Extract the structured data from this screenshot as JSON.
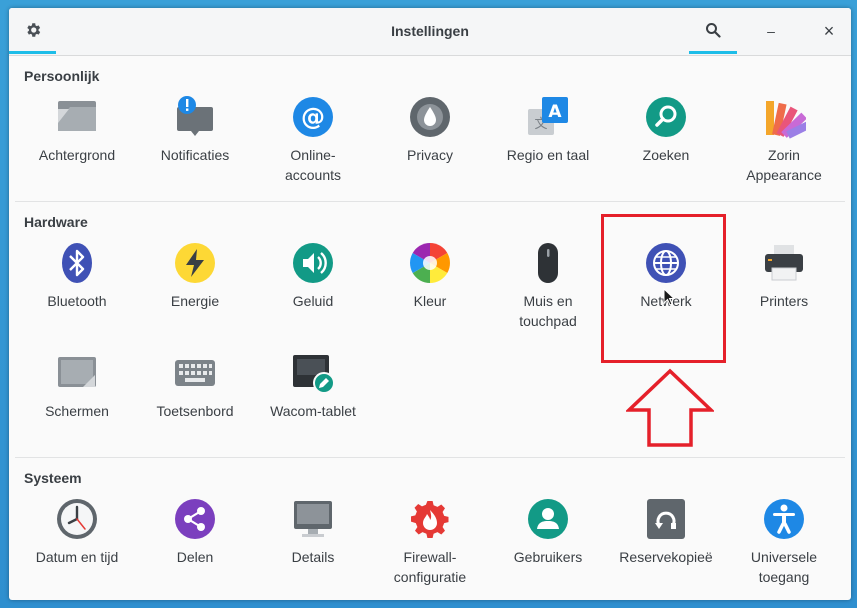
{
  "window": {
    "title": "Instellingen"
  },
  "headerbar": {
    "minimize_glyph": "–",
    "close_glyph": "×"
  },
  "sections": {
    "personal": {
      "title": "Persoonlijk",
      "items": [
        {
          "label1": "Achtergrond",
          "label2": "",
          "icon": "background-icon"
        },
        {
          "label1": "Notificaties",
          "label2": "",
          "icon": "notifications-icon"
        },
        {
          "label1": "Online-",
          "label2": "accounts",
          "icon": "online-accounts-icon"
        },
        {
          "label1": "Privacy",
          "label2": "",
          "icon": "privacy-icon"
        },
        {
          "label1": "Regio en taal",
          "label2": "",
          "icon": "region-language-icon"
        },
        {
          "label1": "Zoeken",
          "label2": "",
          "icon": "search-settings-icon"
        },
        {
          "label1": "Zorin",
          "label2": "Appearance",
          "icon": "zorin-appearance-icon"
        }
      ]
    },
    "hardware": {
      "title": "Hardware",
      "items": [
        {
          "label1": "Bluetooth",
          "label2": "",
          "icon": "bluetooth-icon"
        },
        {
          "label1": "Energie",
          "label2": "",
          "icon": "power-icon"
        },
        {
          "label1": "Geluid",
          "label2": "",
          "icon": "sound-icon"
        },
        {
          "label1": "Kleur",
          "label2": "",
          "icon": "color-icon"
        },
        {
          "label1": "Muis en",
          "label2": "touchpad",
          "icon": "mouse-icon"
        },
        {
          "label1": "Netwerk",
          "label2": "",
          "icon": "network-icon"
        },
        {
          "label1": "Printers",
          "label2": "",
          "icon": "printer-icon"
        },
        {
          "label1": "Schermen",
          "label2": "",
          "icon": "displays-icon"
        },
        {
          "label1": "Toetsenbord",
          "label2": "",
          "icon": "keyboard-icon"
        },
        {
          "label1": "Wacom-tablet",
          "label2": "",
          "icon": "wacom-tablet-icon"
        }
      ]
    },
    "system": {
      "title": "Systeem",
      "items": [
        {
          "label1": "Datum en tijd",
          "label2": "",
          "icon": "clock-icon"
        },
        {
          "label1": "Delen",
          "label2": "",
          "icon": "share-icon"
        },
        {
          "label1": "Details",
          "label2": "",
          "icon": "details-monitor-icon"
        },
        {
          "label1": "Firewall-",
          "label2": "configuratie",
          "icon": "firewall-icon"
        },
        {
          "label1": "Gebruikers",
          "label2": "",
          "icon": "users-icon"
        },
        {
          "label1": "Reservekopieë",
          "label2": "",
          "icon": "backup-icon"
        },
        {
          "label1": "Universele",
          "label2": "toegang",
          "icon": "accessibility-icon"
        }
      ]
    }
  },
  "annotation": {
    "highlight_color": "#e5202a",
    "target": "Netwerk"
  },
  "colors": {
    "accent": "#1dbde8"
  }
}
